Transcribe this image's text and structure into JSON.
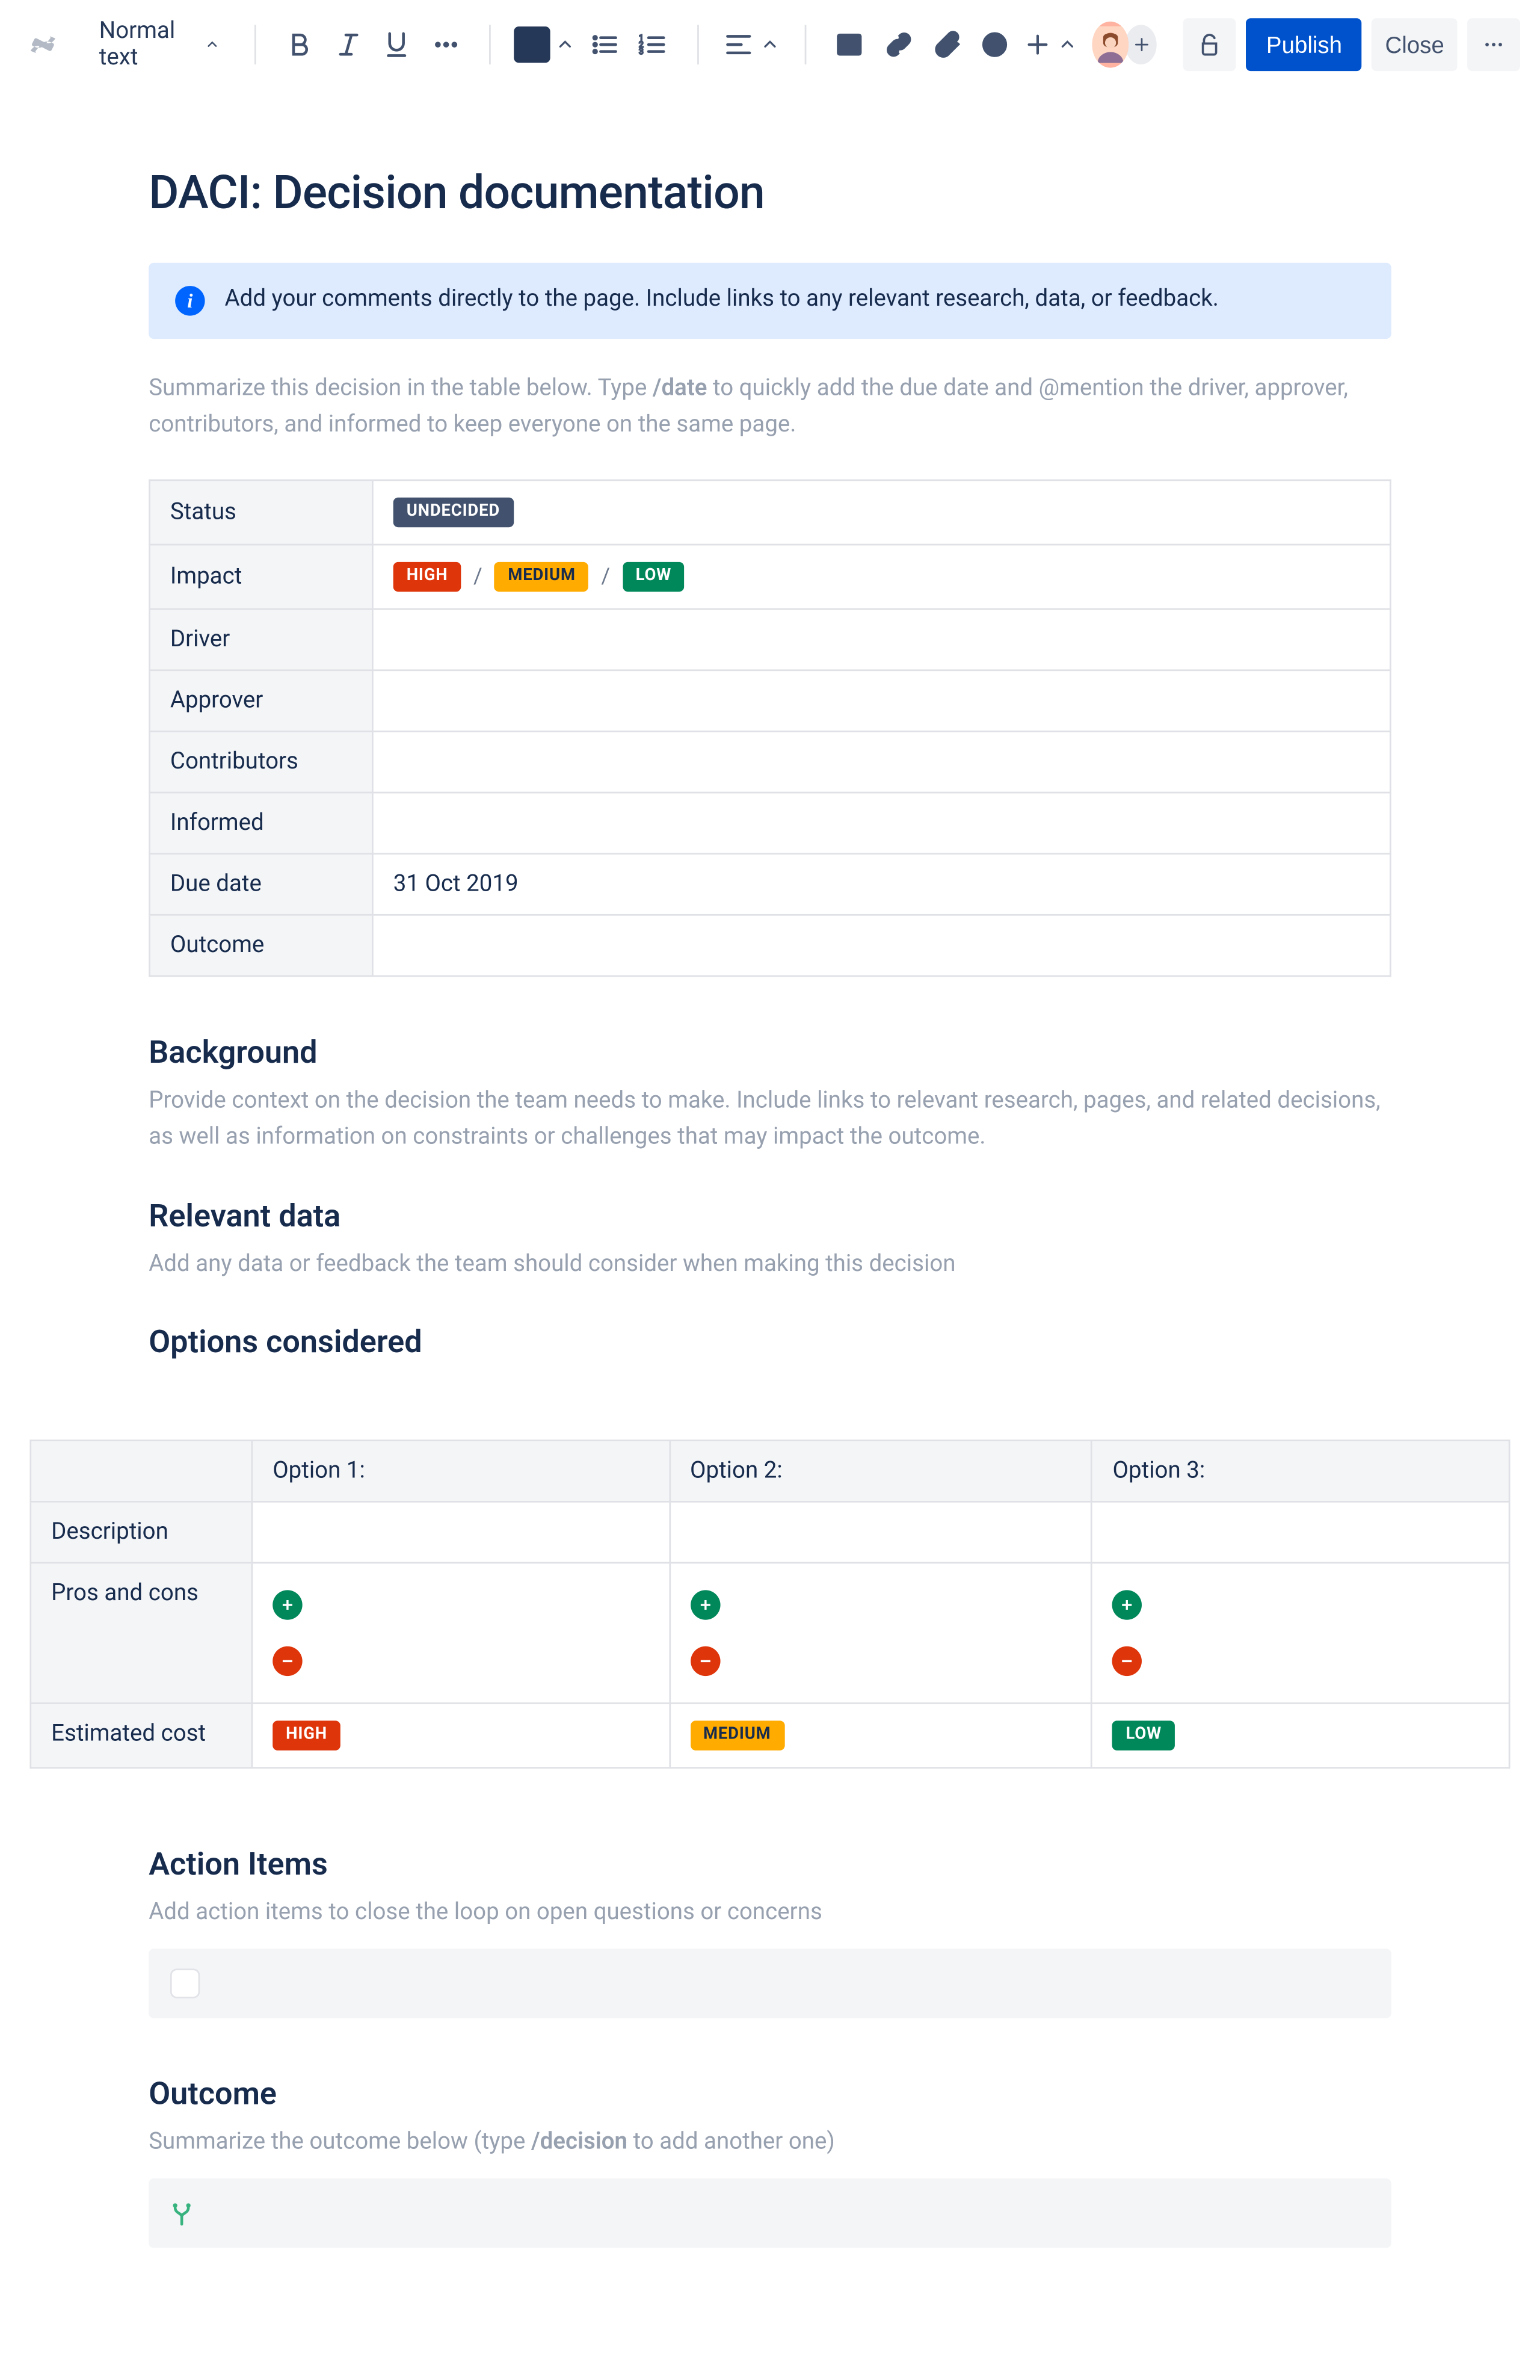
{
  "toolbar": {
    "text_style": "Normal text",
    "publish": "Publish",
    "close": "Close"
  },
  "page": {
    "title": "DACI: Decision documentation",
    "info_panel": "Add your comments directly to the page. Include links to any relevant research, data, or feedback.",
    "intro_before": "Summarize this decision in the table below. Type ",
    "intro_slash": "/date",
    "intro_after": " to quickly add the due date and @mention the driver, approver, contributors, and informed to keep everyone on the same page."
  },
  "summary": {
    "rows": {
      "status": "Status",
      "impact": "Impact",
      "driver": "Driver",
      "approver": "Approver",
      "contributors": "Contributors",
      "informed": "Informed",
      "due_date": "Due date",
      "outcome": "Outcome"
    },
    "status_label": "UNDECIDED",
    "impact": {
      "high": "HIGH",
      "medium": "MEDIUM",
      "low": "LOW"
    },
    "due_date_value": "31 Oct 2019"
  },
  "background": {
    "heading": "Background",
    "desc": "Provide context on the decision the team needs to make. Include links to relevant research, pages, and related decisions, as well as information on constraints or challenges that may impact the outcome."
  },
  "relevant": {
    "heading": "Relevant data",
    "desc": "Add any data or feedback the team should consider when making this decision"
  },
  "options": {
    "heading": "Options considered",
    "cols": [
      "",
      "Option 1:",
      "Option 2:",
      "Option 3:"
    ],
    "rows": {
      "description": "Description",
      "proscons": "Pros and cons",
      "cost": "Estimated cost"
    },
    "cost": {
      "opt1": "HIGH",
      "opt2": "MEDIUM",
      "opt3": "LOW"
    }
  },
  "actions": {
    "heading": "Action Items",
    "desc": "Add action items to close the loop on open questions or concerns"
  },
  "outcome": {
    "heading": "Outcome",
    "desc_before": "Summarize the outcome below (type ",
    "desc_slash": "/decision",
    "desc_after": " to add another one)"
  }
}
